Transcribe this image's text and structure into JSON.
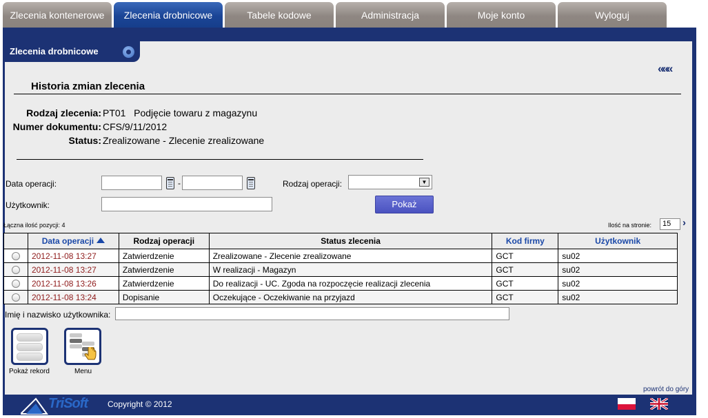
{
  "tabs": [
    "Zlecenia kontenerowe",
    "Zlecenia drobnicowe",
    "Tabele kodowe",
    "Administracja",
    "Moje konto",
    "Wyloguj"
  ],
  "section": {
    "title": "Zlecenia drobnicowe"
  },
  "back_glyph": "«««",
  "page_title": "Historia zmian zlecenia",
  "info": {
    "rodzaj_label": "Rodzaj zlecenia:",
    "rodzaj_value": "PT01   Podjęcie towaru z magazynu",
    "numer_label": "Numer dokumentu:",
    "numer_value": "CFS/9/11/2012",
    "status_label": "Status:",
    "status_value": "Zrealizowane - Zlecenie zrealizowane"
  },
  "filters": {
    "data_label": "Data operacji:",
    "dash": "-",
    "rodzaj_label": "Rodzaj operacji:",
    "user_label": "Użytkownik:",
    "submit": "Pokaż"
  },
  "total_label": "Łączna ilość pozycji: 4",
  "per_page_label": "Ilość na stronie:",
  "per_page_value": "15",
  "next_glyph": "›",
  "table": {
    "headers": [
      "Data operacji",
      "Rodzaj operacji",
      "Status zlecenia",
      "Kod firmy",
      "Użytkownik"
    ],
    "rows": [
      [
        "2012-11-08 13:27",
        "Zatwierdzenie",
        "Zrealizowane - Zlecenie zrealizowane",
        "GCT",
        "su02"
      ],
      [
        "2012-11-08 13:27",
        "Zatwierdzenie",
        "W realizacji - Magazyn",
        "GCT",
        "su02"
      ],
      [
        "2012-11-08 13:26",
        "Zatwierdzenie",
        "Do realizacji - UC. Zgoda na rozpoczęcie realizacji zlecenia",
        "GCT",
        "su02"
      ],
      [
        "2012-11-08 13:24",
        "Dopisanie",
        "Oczekujące - Oczekiwanie na przyjazd",
        "GCT",
        "su02"
      ]
    ]
  },
  "name_label": "Imię i nazwisko użytkownika:",
  "buttons": {
    "show_record": "Pokaż rekord",
    "menu": "Menu"
  },
  "back_to_top": "powrót do góry",
  "footer": {
    "logo": "TriSoft",
    "copyright": "Copyright © 2012"
  },
  "colors": {
    "navy": "#1c3274",
    "active_tab": "#1b4596",
    "inactive_tab": "#8f8782",
    "panel": "#ececec",
    "date_text": "#8e1a1a",
    "link": "#1a48a8"
  }
}
